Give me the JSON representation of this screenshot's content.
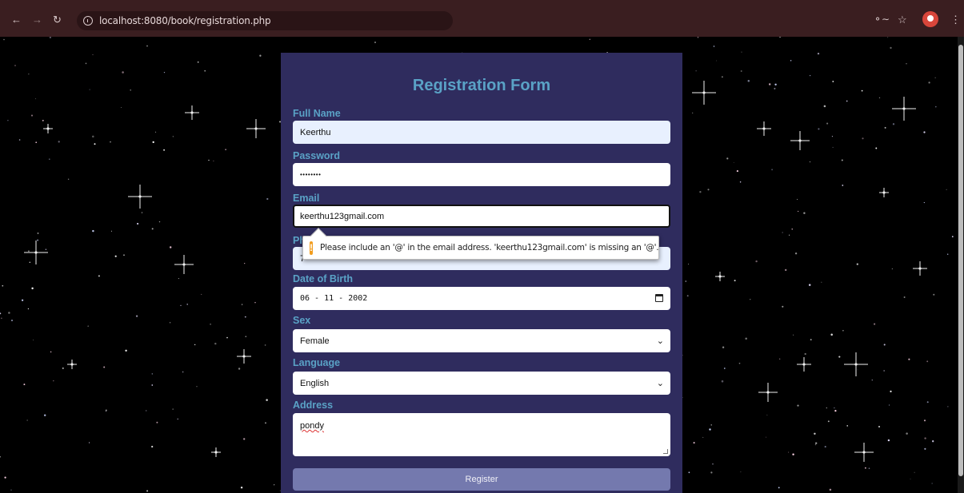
{
  "browser": {
    "url": "localhost:8080/book/registration.php",
    "icons": [
      "back-arrow-icon",
      "forward-arrow-icon",
      "reload-icon",
      "site-info-icon",
      "password-key-icon",
      "bookmark-star-icon",
      "profile-icon",
      "menu-kebab-icon"
    ]
  },
  "form": {
    "title": "Registration Form",
    "fields": {
      "full_name": {
        "label": "Full Name",
        "value": "Keerthu"
      },
      "password": {
        "label": "Password",
        "value": "••••••••"
      },
      "email": {
        "label": "Email",
        "value": "keerthu123gmail.com"
      },
      "phone": {
        "label": "Ph",
        "value": "7"
      },
      "dob": {
        "label": "Date of Birth",
        "value": "06 - 11 - 2002"
      },
      "sex": {
        "label": "Sex",
        "value": "Female"
      },
      "language": {
        "label": "Language",
        "value": "English"
      },
      "address": {
        "label": "Address",
        "value": "pondy"
      }
    },
    "submit_label": "Register"
  },
  "tooltip": {
    "message": "Please include an '@' in the email address. 'keerthu123gmail.com' is missing an '@'."
  },
  "colors": {
    "panel": "#2f2c5e",
    "label": "#5aa2c6",
    "button": "#7479ae",
    "chrome": "#3a1e20",
    "warning": "#f29d1e"
  }
}
